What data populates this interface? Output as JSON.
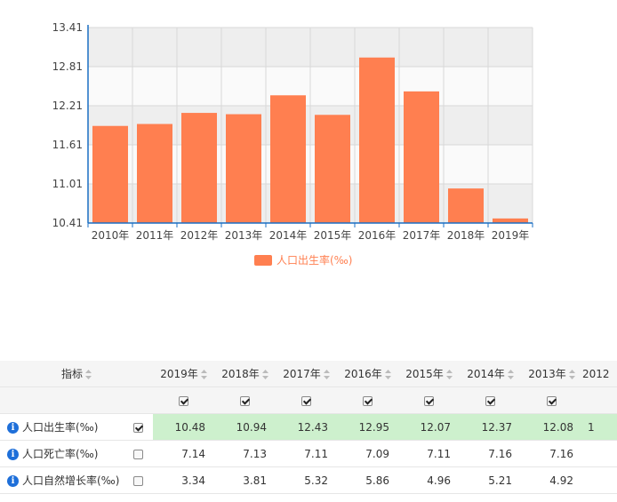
{
  "chart_data": {
    "type": "bar",
    "categories": [
      "2010年",
      "2011年",
      "2012年",
      "2013年",
      "2014年",
      "2015年",
      "2016年",
      "2017年",
      "2018年",
      "2019年"
    ],
    "series": [
      {
        "name": "人口出生率(‰)",
        "values": [
          11.9,
          11.93,
          12.1,
          12.08,
          12.37,
          12.07,
          12.95,
          12.43,
          10.94,
          10.48
        ],
        "color": "#ff7f50"
      }
    ],
    "yticks": [
      "13.41",
      "12.81",
      "12.21",
      "11.61",
      "11.01",
      "10.41"
    ],
    "ylim": [
      10.41,
      13.41
    ],
    "grid": true,
    "legend_position": "bottom-center"
  },
  "table": {
    "header_label": "指标",
    "years": [
      "2019年",
      "2018年",
      "2017年",
      "2016年",
      "2015年",
      "2014年",
      "2013年",
      "2012"
    ],
    "rows": [
      {
        "name": "人口出生率(‰)",
        "checked": true,
        "values": [
          "10.48",
          "10.94",
          "12.43",
          "12.95",
          "12.07",
          "12.37",
          "12.08",
          "1"
        ]
      },
      {
        "name": "人口死亡率(‰)",
        "checked": false,
        "values": [
          "7.14",
          "7.13",
          "7.11",
          "7.09",
          "7.11",
          "7.16",
          "7.16",
          ""
        ]
      },
      {
        "name": "人口自然增长率(‰)",
        "checked": false,
        "values": [
          "3.34",
          "3.81",
          "5.32",
          "5.86",
          "4.96",
          "5.21",
          "4.92",
          ""
        ]
      }
    ]
  }
}
